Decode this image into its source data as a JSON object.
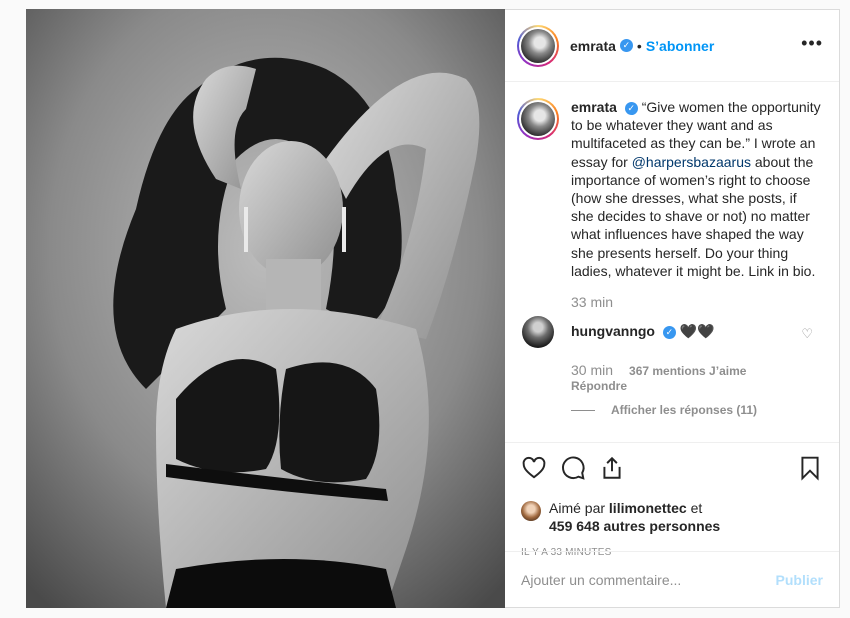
{
  "post": {
    "username": "emrata",
    "follow_label": "S’abonner",
    "more_icon": "more-horizontal-icon",
    "caption": {
      "quote": "“Give women the opportunity to be whatever they want and as multifaceted as they can be.” I wrote an essay for ",
      "mention": "@harpersbazaarus",
      "rest": " about the importance of women’s right to choose (how she dresses, what she posts, if she decides to shave or not) no matter what influences have shaped the way she presents herself. Do your thing ladies, whatever it might be. Link in bio.",
      "time": "33 min"
    },
    "top_comment": {
      "username": "hungvanngo",
      "text": "🖤🖤",
      "time": "30 min",
      "likes": "367 mentions J’aime",
      "reply_label": "Répondre",
      "view_replies": "Afficher les réponses (11)"
    },
    "likes": {
      "prefix": "Aimé par ",
      "liker": "lilimonettec",
      "middle": " et",
      "others": "459 648 autres personnes"
    },
    "timestamp": "IL Y A 33 MINUTES",
    "add_comment": {
      "placeholder": "Ajouter un commentaire...",
      "publish_label": "Publier"
    }
  },
  "colors": {
    "link_blue": "#0095f6",
    "verified_blue": "#3897f0",
    "publish_disabled": "#b2dffc",
    "muted_text": "#8e8e8e"
  }
}
